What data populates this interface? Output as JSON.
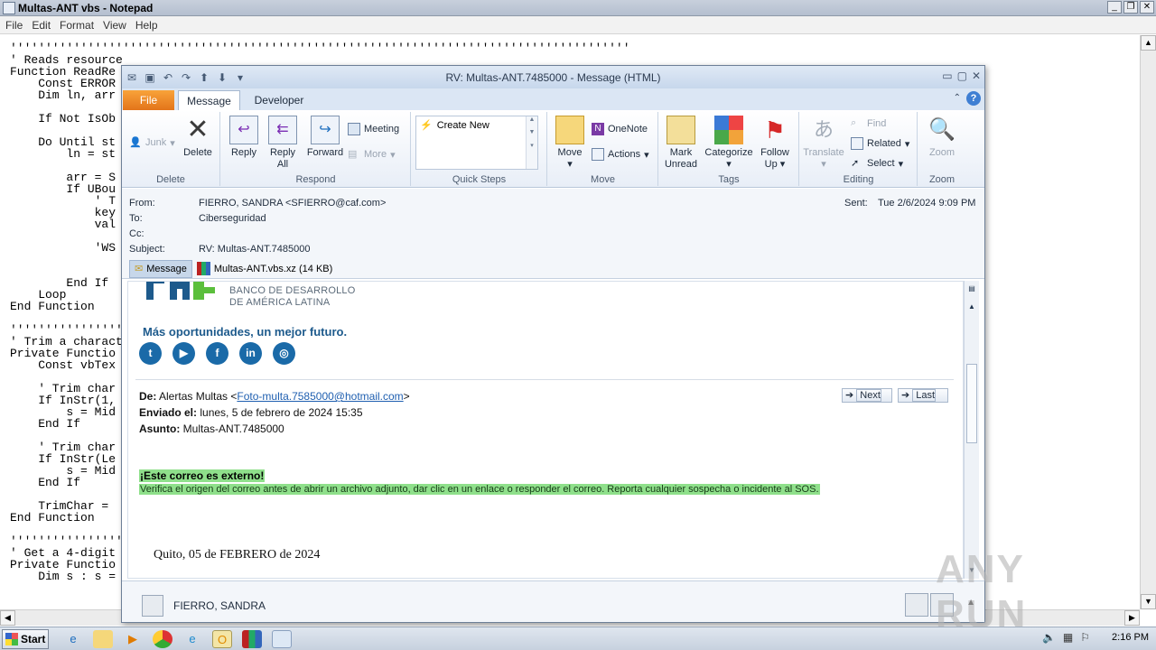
{
  "notepad": {
    "title": "Multas-ANT vbs - Notepad",
    "menu": [
      "File",
      "Edit",
      "Format",
      "View",
      "Help"
    ],
    "code_lines": [
      "''''''''''''''''''''''''''''''''''''''''''''''''''''''''''''''''''''''''''''''''''''''''",
      "' Reads resource",
      "Function ReadRe",
      "    Const ERROR",
      "    Dim ln, arr",
      "",
      "    If Not IsOb",
      "",
      "    Do Until st",
      "        ln = st",
      "",
      "        arr = S",
      "        If UBou",
      "            ' T",
      "            key",
      "            val",
      "",
      "            'WS",
      "",
      "",
      "        End If",
      "    Loop",
      "End Function",
      "",
      "''''''''''''''''''",
      "' Trim a charact",
      "Private Functio",
      "    Const vbTex",
      "",
      "    ' Trim char",
      "    If InStr(1,",
      "        s = Mid",
      "    End If",
      "",
      "    ' Trim char",
      "    If InStr(Le",
      "        s = Mid",
      "    End If",
      "",
      "    TrimChar =",
      "End Function",
      "",
      "''''''''''''''''''",
      "' Get a 4-digit",
      "Private Functio",
      "    Dim s : s ="
    ]
  },
  "outlook": {
    "title": "RV: Multas-ANT.7485000  -  Message (HTML)",
    "tabs": {
      "file": "File",
      "message": "Message",
      "developer": "Developer"
    },
    "ribbon": {
      "delete_group": {
        "label": "Delete",
        "junk": "Junk",
        "delete": "Delete"
      },
      "respond_group": {
        "label": "Respond",
        "reply": "Reply",
        "reply_all_1": "Reply",
        "reply_all_2": "All",
        "forward": "Forward",
        "meeting": "Meeting",
        "more": "More"
      },
      "quick_steps_group": {
        "label": "Quick Steps",
        "create_new": "Create New"
      },
      "move_group": {
        "label": "Move",
        "move": "Move",
        "onenote": "OneNote",
        "actions": "Actions"
      },
      "tags_group": {
        "label": "Tags",
        "mark_unread_1": "Mark",
        "mark_unread_2": "Unread",
        "categorize": "Categorize",
        "follow_up_1": "Follow",
        "follow_up_2": "Up"
      },
      "editing_group": {
        "label": "Editing",
        "translate": "Translate",
        "find": "Find",
        "related": "Related",
        "select": "Select"
      },
      "zoom_group": {
        "label": "Zoom",
        "zoom": "Zoom"
      }
    },
    "header": {
      "from_label": "From:",
      "from": "FIERRO, SANDRA <SFIERRO@caf.com>",
      "to_label": "To:",
      "to": "Ciberseguridad",
      "cc_label": "Cc:",
      "cc": "",
      "subject_label": "Subject:",
      "subject": "RV: Multas-ANT.7485000",
      "sent_label": "Sent:",
      "sent": "Tue 2/6/2024 9:09 PM"
    },
    "attachments": {
      "message_tab": "Message",
      "file": "Multas-ANT.vbs.xz (14 KB)"
    },
    "body": {
      "org_line1": "BANCO DE DESARROLLO",
      "org_line2": "DE AMÉRICA LATINA",
      "slogan": "Más oportunidades, un mejor futuro.",
      "social": [
        "twitter",
        "youtube",
        "facebook",
        "linkedin",
        "instagram"
      ],
      "fwd_from_label": "De:",
      "fwd_from_name": "Alertas Multas <",
      "fwd_from_email": "Foto-multa.7585000@hotmail.com",
      "fwd_from_end": ">",
      "fwd_sent_label": "Enviado el:",
      "fwd_sent": "lunes, 5 de febrero de 2024 15:35",
      "fwd_subject_label": "Asunto:",
      "fwd_subject": "Multas-ANT.7485000",
      "next_btn": "Next",
      "last_btn": "Last",
      "external_title": "¡Este correo es externo!",
      "external_text": "Verifica el origen del correo antes de abrir un archivo adjunto, dar clic en un enlace o responder el correo. Reporta cualquier sospecha o incidente al SOS.",
      "letter_date": "Quito, 05 de FEBRERO de 2024"
    },
    "people_pane": {
      "name": "FIERRO, SANDRA"
    }
  },
  "watermark": "ANY RUN",
  "taskbar": {
    "start": "Start",
    "clock": "2:16 PM"
  }
}
